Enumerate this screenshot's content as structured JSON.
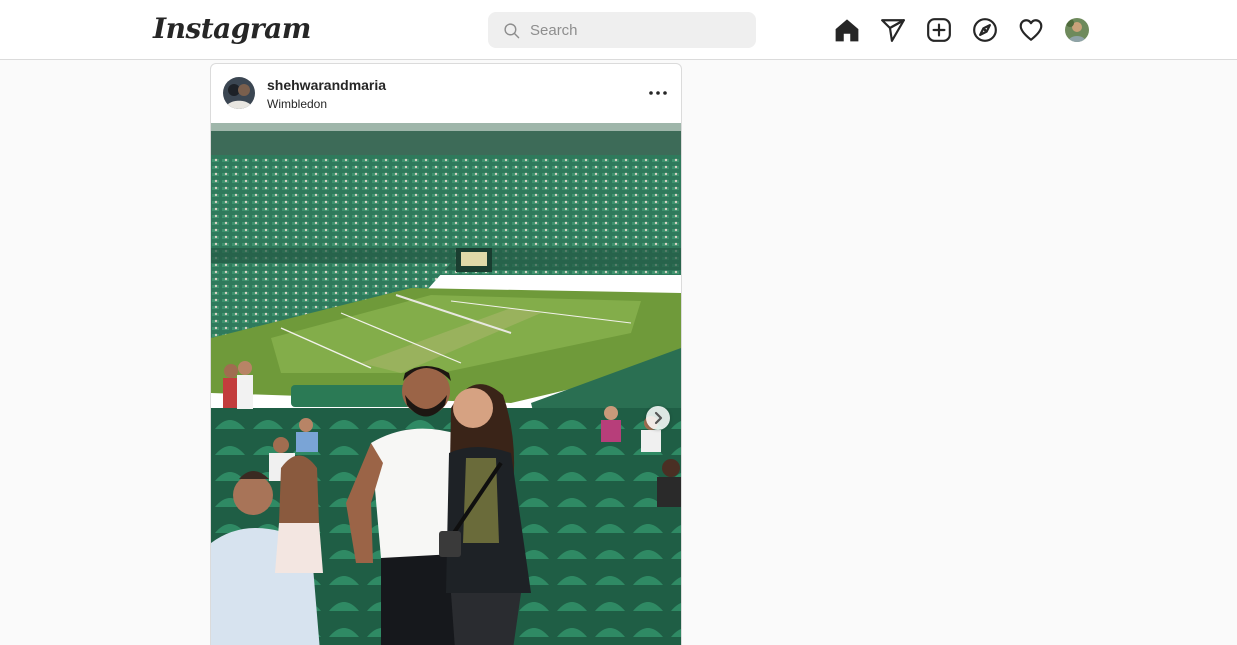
{
  "app": {
    "logo_text": "Instagram"
  },
  "search": {
    "placeholder": "Search",
    "value": ""
  },
  "nav": {
    "icons": [
      "home-icon",
      "direct-message-icon",
      "new-post-icon",
      "explore-icon",
      "activity-heart-icon",
      "profile-avatar"
    ]
  },
  "post": {
    "username": "shehwarandmaria",
    "location": "Wimbledon",
    "photo_subject": "Two people posing in the stands of a grass tennis court stadium",
    "carousel_next_icon": "chevron-right-icon",
    "more_icon": "more-options-icon"
  },
  "colors": {
    "background": "#fafafa",
    "surface": "#ffffff",
    "border": "#dbdbdb",
    "text": "#262626",
    "muted": "#8e8e8e",
    "search_bg": "#efefef"
  }
}
